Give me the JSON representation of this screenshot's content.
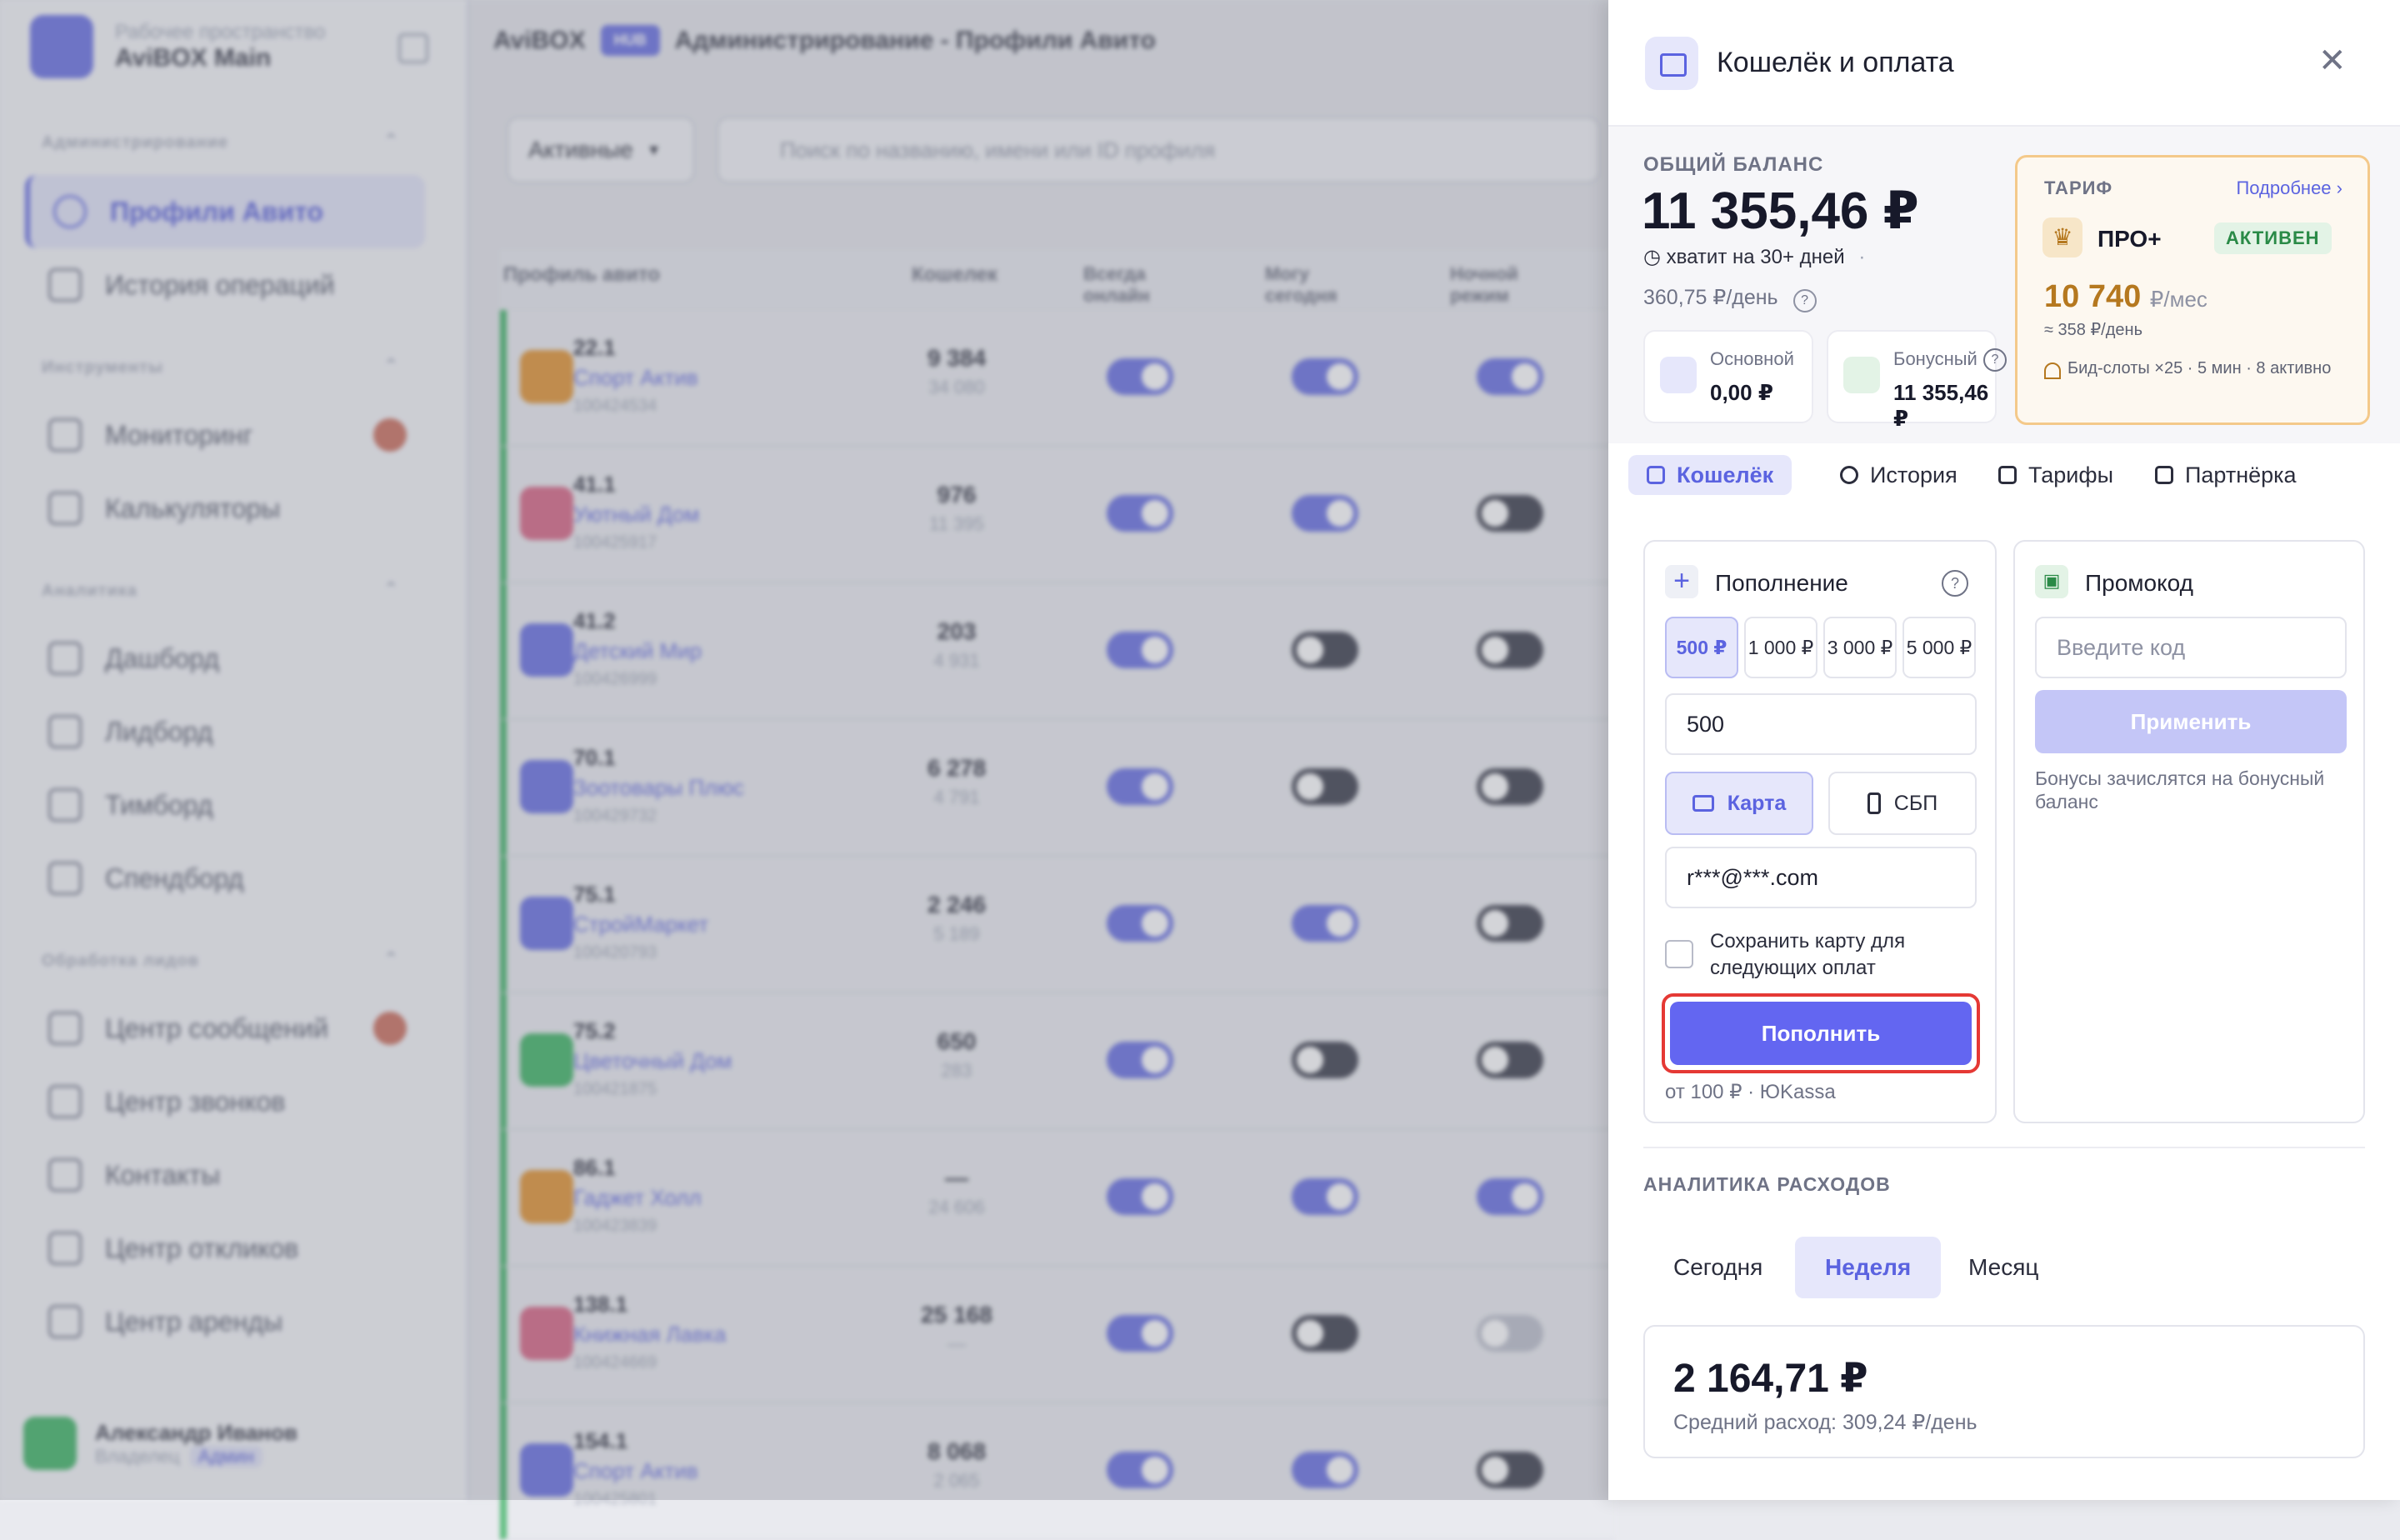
{
  "workspace": {
    "subtitle": "Рабочее пространство",
    "name": "AviBOX Main"
  },
  "sidebar": {
    "sections": [
      {
        "label": "Администрирование"
      },
      {
        "label": "Инструменты"
      },
      {
        "label": "Аналитика"
      },
      {
        "label": "Обработка лидов"
      }
    ],
    "items": [
      {
        "label": "Профили Авито"
      },
      {
        "label": "История операций"
      },
      {
        "label": "Мониторинг"
      },
      {
        "label": "Калькуляторы"
      },
      {
        "label": "Дашборд"
      },
      {
        "label": "Лидборд"
      },
      {
        "label": "Тимборд"
      },
      {
        "label": "Спендборд"
      },
      {
        "label": "Центр сообщений"
      },
      {
        "label": "Центр звонков"
      },
      {
        "label": "Контакты"
      },
      {
        "label": "Центр откликов"
      },
      {
        "label": "Центр аренды"
      }
    ],
    "user": {
      "name": "Александр Иванов",
      "role": "Владелец",
      "tag": "Админ"
    }
  },
  "main": {
    "brand": "AviBOX",
    "hub": "HUB",
    "title": "Администрирование - Профили Авито",
    "filter": "Активные",
    "search_placeholder": "Поиск по названию, имени или ID профиля",
    "columns": [
      "Профиль авито",
      "Кошелек",
      "Всегда онлайн",
      "Могу сегодня",
      "Ночной режим"
    ],
    "rows": [
      {
        "num": "22.1",
        "name": "Спорт Актив",
        "id": "100424534",
        "w1": "9 384",
        "w2": "34 080"
      },
      {
        "num": "41.1",
        "name": "Уютный Дом",
        "id": "100425917",
        "w1": "976",
        "w2": "11 395"
      },
      {
        "num": "41.2",
        "name": "Детский Мир",
        "id": "100426999",
        "w1": "203",
        "w2": "4 931"
      },
      {
        "num": "70.1",
        "name": "Зоотовары Плюс",
        "id": "100429732",
        "w1": "6 278",
        "w2": "4 791"
      },
      {
        "num": "75.1",
        "name": "СтройМаркет",
        "id": "100420793",
        "w1": "2 246",
        "w2": "5 189"
      },
      {
        "num": "75.2",
        "name": "Цветочный Дом",
        "id": "100421875",
        "w1": "650",
        "w2": "283"
      },
      {
        "num": "86.1",
        "name": "Гаджет Холл",
        "id": "100423839",
        "w1": "—",
        "w2": "24 606"
      },
      {
        "num": "138.1",
        "name": "Книжная Лавка",
        "id": "100424669",
        "w1": "25 168",
        "w2": "—"
      },
      {
        "num": "154.1",
        "name": "Спорт Актив",
        "id": "100425801",
        "w1": "8 068",
        "w2": "2 065"
      }
    ]
  },
  "panel": {
    "title": "Кошелёк и оплата",
    "balance_label": "ОБЩИЙ БАЛАНС",
    "balance_amount": "11 355,46 ₽",
    "balance_enough": "хватит на 30+ дней",
    "balance_rate": "360,75 ₽/день",
    "main_label": "Основной",
    "main_value": "0,00 ₽",
    "bonus_label": "Бонусный",
    "bonus_value": "11 355,46 ₽",
    "tariff": {
      "label": "ТАРИФ",
      "more": "Подробнее",
      "plan": "ПРО+",
      "status": "АКТИВЕН",
      "price": "10 740",
      "price_unit": "₽/мес",
      "per_day": "≈ 358 ₽/день",
      "slots": "Бид-слоты ×25 · 5 мин · 8 активно"
    },
    "tabs": [
      "Кошелёк",
      "История",
      "Тарифы",
      "Партнёрка"
    ],
    "topup": {
      "title": "Пополнение",
      "chips": [
        "500 ₽",
        "1 000 ₽",
        "3 000 ₽",
        "5 000 ₽"
      ],
      "amount": "500",
      "card": "Карта",
      "sbp": "СБП",
      "email": "r***@***.com",
      "save_card": "Сохранить карту для следующих оплат",
      "button": "Пополнить",
      "note": "от 100 ₽ · ЮKassa"
    },
    "promo": {
      "title": "Промокод",
      "placeholder": "Введите код",
      "button": "Применить",
      "note": "Бонусы зачислятся на бонусный баланс"
    },
    "analytics": {
      "label": "АНАЛИТИКА РАСХОДОВ",
      "periods": [
        "Сегодня",
        "Неделя",
        "Месяц"
      ],
      "total": "2 164,71 ₽",
      "avg": "Средний расход: 309,24 ₽/день"
    }
  },
  "colors": {
    "accent": "#6366f1",
    "success": "#2eae57",
    "warning": "#b5781f",
    "highlight": "#e53935"
  }
}
